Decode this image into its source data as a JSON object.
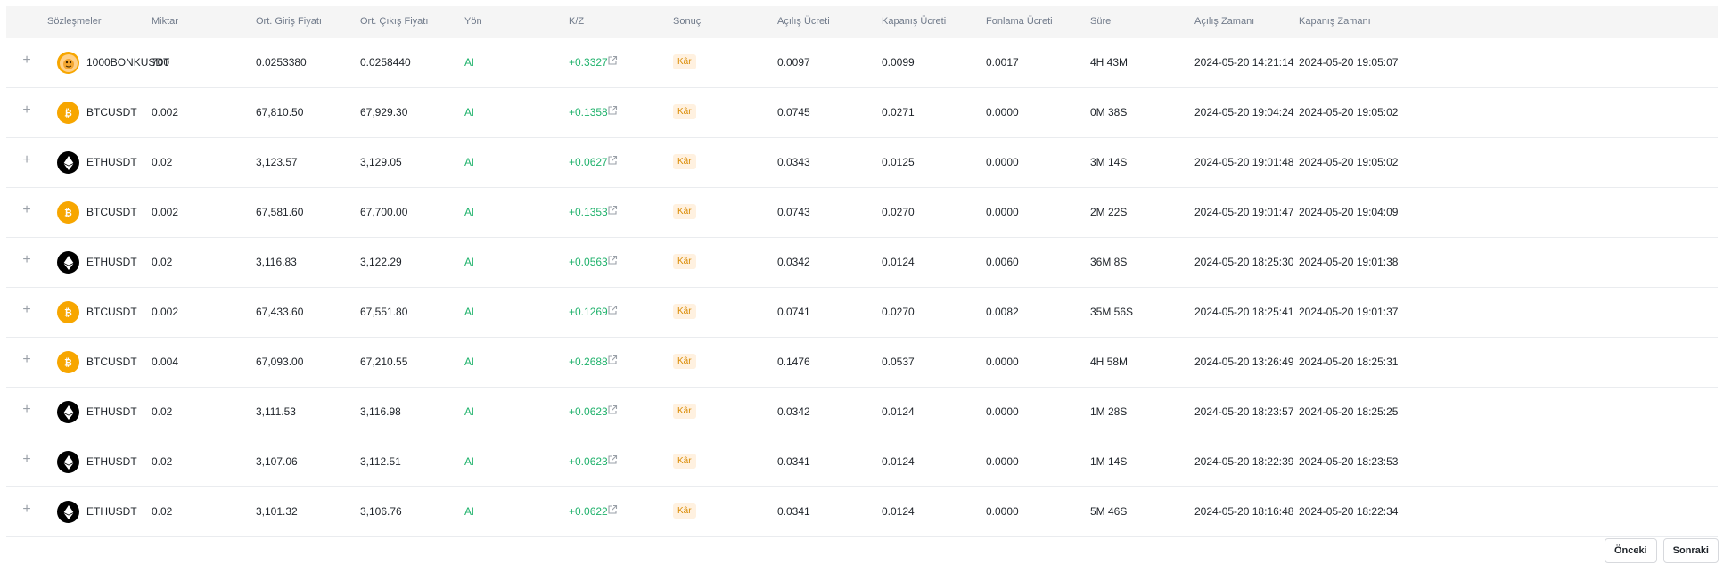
{
  "columns": [
    "Sözleşmeler",
    "Miktar",
    "Ort. Giriş Fiyatı",
    "Ort. Çıkış Fiyatı",
    "Yön",
    "K/Z",
    "Sonuç",
    "Açılış Ücreti",
    "Kapanış Ücreti",
    "Fonlama Ücreti",
    "Süre",
    "Açılış Zamanı",
    "Kapanış Zamanı"
  ],
  "rows": [
    {
      "coin": "bonk",
      "symbol": "1000BONKUSDT",
      "qty": "700",
      "entry": "0.0253380",
      "exit": "0.0258440",
      "side": "Al",
      "pnl": "+0.3327",
      "result": "Kâr",
      "open_fee": "0.0097",
      "close_fee": "0.0099",
      "funding_fee": "0.0017",
      "duration": "4H 43M",
      "open_time": "2024-05-20 14:21:14",
      "close_time": "2024-05-20 19:05:07"
    },
    {
      "coin": "btc",
      "symbol": "BTCUSDT",
      "qty": "0.002",
      "entry": "67,810.50",
      "exit": "67,929.30",
      "side": "Al",
      "pnl": "+0.1358",
      "result": "Kâr",
      "open_fee": "0.0745",
      "close_fee": "0.0271",
      "funding_fee": "0.0000",
      "duration": "0M 38S",
      "open_time": "2024-05-20 19:04:24",
      "close_time": "2024-05-20 19:05:02"
    },
    {
      "coin": "eth",
      "symbol": "ETHUSDT",
      "qty": "0.02",
      "entry": "3,123.57",
      "exit": "3,129.05",
      "side": "Al",
      "pnl": "+0.0627",
      "result": "Kâr",
      "open_fee": "0.0343",
      "close_fee": "0.0125",
      "funding_fee": "0.0000",
      "duration": "3M 14S",
      "open_time": "2024-05-20 19:01:48",
      "close_time": "2024-05-20 19:05:02"
    },
    {
      "coin": "btc",
      "symbol": "BTCUSDT",
      "qty": "0.002",
      "entry": "67,581.60",
      "exit": "67,700.00",
      "side": "Al",
      "pnl": "+0.1353",
      "result": "Kâr",
      "open_fee": "0.0743",
      "close_fee": "0.0270",
      "funding_fee": "0.0000",
      "duration": "2M 22S",
      "open_time": "2024-05-20 19:01:47",
      "close_time": "2024-05-20 19:04:09"
    },
    {
      "coin": "eth",
      "symbol": "ETHUSDT",
      "qty": "0.02",
      "entry": "3,116.83",
      "exit": "3,122.29",
      "side": "Al",
      "pnl": "+0.0563",
      "result": "Kâr",
      "open_fee": "0.0342",
      "close_fee": "0.0124",
      "funding_fee": "0.0060",
      "duration": "36M 8S",
      "open_time": "2024-05-20 18:25:30",
      "close_time": "2024-05-20 19:01:38"
    },
    {
      "coin": "btc",
      "symbol": "BTCUSDT",
      "qty": "0.002",
      "entry": "67,433.60",
      "exit": "67,551.80",
      "side": "Al",
      "pnl": "+0.1269",
      "result": "Kâr",
      "open_fee": "0.0741",
      "close_fee": "0.0270",
      "funding_fee": "0.0082",
      "duration": "35M 56S",
      "open_time": "2024-05-20 18:25:41",
      "close_time": "2024-05-20 19:01:37"
    },
    {
      "coin": "btc",
      "symbol": "BTCUSDT",
      "qty": "0.004",
      "entry": "67,093.00",
      "exit": "67,210.55",
      "side": "Al",
      "pnl": "+0.2688",
      "result": "Kâr",
      "open_fee": "0.1476",
      "close_fee": "0.0537",
      "funding_fee": "0.0000",
      "duration": "4H 58M",
      "open_time": "2024-05-20 13:26:49",
      "close_time": "2024-05-20 18:25:31"
    },
    {
      "coin": "eth",
      "symbol": "ETHUSDT",
      "qty": "0.02",
      "entry": "3,111.53",
      "exit": "3,116.98",
      "side": "Al",
      "pnl": "+0.0623",
      "result": "Kâr",
      "open_fee": "0.0342",
      "close_fee": "0.0124",
      "funding_fee": "0.0000",
      "duration": "1M 28S",
      "open_time": "2024-05-20 18:23:57",
      "close_time": "2024-05-20 18:25:25"
    },
    {
      "coin": "eth",
      "symbol": "ETHUSDT",
      "qty": "0.02",
      "entry": "3,107.06",
      "exit": "3,112.51",
      "side": "Al",
      "pnl": "+0.0623",
      "result": "Kâr",
      "open_fee": "0.0341",
      "close_fee": "0.0124",
      "funding_fee": "0.0000",
      "duration": "1M 14S",
      "open_time": "2024-05-20 18:22:39",
      "close_time": "2024-05-20 18:23:53"
    },
    {
      "coin": "eth",
      "symbol": "ETHUSDT",
      "qty": "0.02",
      "entry": "3,101.32",
      "exit": "3,106.76",
      "side": "Al",
      "pnl": "+0.0622",
      "result": "Kâr",
      "open_fee": "0.0341",
      "close_fee": "0.0124",
      "funding_fee": "0.0000",
      "duration": "5M 46S",
      "open_time": "2024-05-20 18:16:48",
      "close_time": "2024-05-20 18:22:34"
    }
  ],
  "expand_symbol": "+",
  "pagination": {
    "prev": "Önceki",
    "next": "Sonraki"
  },
  "colors": {
    "buy": "#20b26c",
    "profit_badge_bg": "#fff1e0",
    "profit_badge_text": "#d98a00",
    "btc": "#f7a600",
    "eth": "#000000"
  },
  "icons": {
    "expand": "plus-icon",
    "link": "external-link-icon",
    "btc": "bitcoin-icon",
    "eth": "ethereum-icon",
    "bonk": "bonk-icon"
  }
}
